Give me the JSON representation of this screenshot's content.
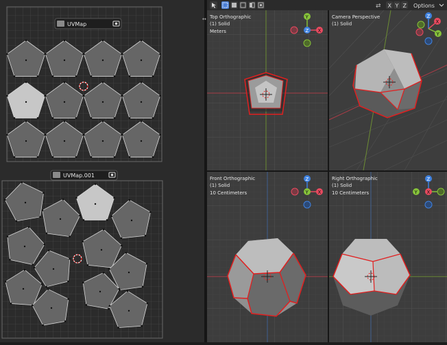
{
  "uv_panels": [
    {
      "name": "UVMap"
    },
    {
      "name": "UVMap.001"
    }
  ],
  "header": {
    "axis_x": "X",
    "axis_y": "Y",
    "axis_z": "Z",
    "options_label": "Options"
  },
  "viewports": [
    {
      "title": "Top Orthographic",
      "mode": "(1) Solid",
      "scale": "Meters"
    },
    {
      "title": "Camera Perspective",
      "mode": "(1) Solid",
      "scale": ""
    },
    {
      "title": "Front Orthographic",
      "mode": "(1) Solid",
      "scale": "10 Centimeters"
    },
    {
      "title": "Right Orthographic",
      "mode": "(1) Solid",
      "scale": "10 Centimeters"
    }
  ],
  "gizmos": [
    {
      "center": "Z",
      "labels": [
        "Y",
        "X",
        "Z"
      ]
    },
    {
      "center": "",
      "labels": [
        "Z",
        "X",
        "Y"
      ]
    },
    {
      "center": "Y",
      "labels": [
        "Z",
        "X"
      ]
    },
    {
      "center": "X",
      "labels": [
        "Z",
        "Y"
      ]
    }
  ],
  "colors": {
    "grid_bg": "#3d3d3d",
    "uv_face": "#666666",
    "uv_face_selected": "#c7c7c7",
    "mesh_light": "#bdbdbd",
    "mesh_mid": "#8f8f8f",
    "mesh_dark": "#5c5c5c",
    "seam": "#e11f1f",
    "axis_x": "#e84a5f",
    "axis_y": "#86c23a",
    "axis_z": "#3f82e0",
    "accent": "#4b7fd6"
  }
}
